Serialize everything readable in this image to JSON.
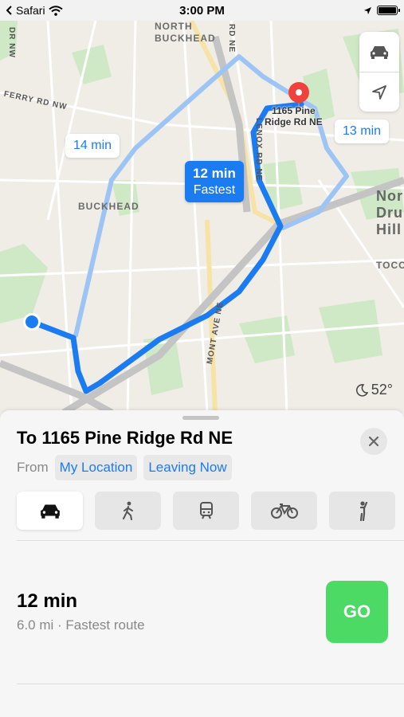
{
  "status_bar": {
    "back_app": "Safari",
    "time": "3:00 PM"
  },
  "map": {
    "labels": {
      "north_buckhead": "NORTH\nBUCKHEAD",
      "buckhead": "BUCKHEAD",
      "north_druid_hills": "Nor\nDru\nHill",
      "toco": "TOCO",
      "ferry_rd": "FERRY RD NW",
      "dr_nw": "DR NW",
      "rd_ne": "RD NE",
      "lenox_rd": "LENOX RD NE",
      "mont_ave": "MONT AVE NE"
    },
    "callouts": {
      "alt_left": "14 min",
      "alt_right": "13 min",
      "fastest_time": "12 min",
      "fastest_label": "Fastest"
    },
    "destination_label": "1165 Pine\nRidge Rd NE",
    "weather": {
      "icon": "moon-icon",
      "temp": "52°"
    },
    "colors": {
      "route_primary": "#1a7cf0",
      "route_alt": "#9cc4f5",
      "destination_pin": "#f0413c"
    }
  },
  "sheet": {
    "title": "To 1165 Pine Ridge Rd NE",
    "from_label": "From",
    "from_chip": "My Location",
    "time_chip": "Leaving Now",
    "modes": [
      "car-icon",
      "walk-icon",
      "transit-icon",
      "bike-icon",
      "rideshare-icon"
    ],
    "route": {
      "time": "12 min",
      "detail": "6.0 mi · Fastest route",
      "go_label": "GO"
    },
    "colors": {
      "go": "#4cd964",
      "accent": "#1a7cf0"
    }
  }
}
